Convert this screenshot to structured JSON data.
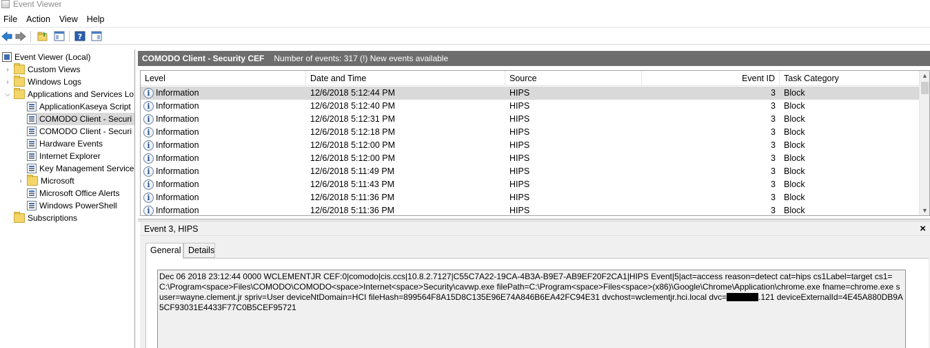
{
  "window": {
    "title": "Event Viewer"
  },
  "menu": [
    "File",
    "Action",
    "View",
    "Help"
  ],
  "toolbar": {
    "buttons": [
      "back-icon",
      "forward-icon",
      "open-folder-icon",
      "show-hide-tree-icon",
      "help-icon",
      "show-hide-action-pane-icon"
    ]
  },
  "tree": {
    "root": "Event Viewer (Local)",
    "custom_views": "Custom Views",
    "windows_logs": "Windows Logs",
    "apps_services": "Applications and Services Lo",
    "children": [
      "ApplicationKaseya Script",
      "COMODO Client - Securi",
      "COMODO Client - Securi",
      "Hardware Events",
      "Internet Explorer",
      "Key Management Service",
      "Microsoft",
      "Microsoft Office Alerts",
      "Windows PowerShell"
    ],
    "subscriptions": "Subscriptions"
  },
  "header": {
    "log_name": "COMODO Client - Security CEF",
    "event_count": "Number of events: 317 (!) New events available"
  },
  "grid": {
    "columns": {
      "level": "Level",
      "datetime": "Date and Time",
      "source": "Source",
      "event_id": "Event ID",
      "task_category": "Task Category"
    },
    "rows": [
      {
        "level": "Information",
        "datetime": "12/6/2018 5:12:44 PM",
        "source": "HIPS",
        "event_id": "3",
        "task": "Block"
      },
      {
        "level": "Information",
        "datetime": "12/6/2018 5:12:40 PM",
        "source": "HIPS",
        "event_id": "3",
        "task": "Block"
      },
      {
        "level": "Information",
        "datetime": "12/6/2018 5:12:31 PM",
        "source": "HIPS",
        "event_id": "3",
        "task": "Block"
      },
      {
        "level": "Information",
        "datetime": "12/6/2018 5:12:18 PM",
        "source": "HIPS",
        "event_id": "3",
        "task": "Block"
      },
      {
        "level": "Information",
        "datetime": "12/6/2018 5:12:00 PM",
        "source": "HIPS",
        "event_id": "3",
        "task": "Block"
      },
      {
        "level": "Information",
        "datetime": "12/6/2018 5:12:00 PM",
        "source": "HIPS",
        "event_id": "3",
        "task": "Block"
      },
      {
        "level": "Information",
        "datetime": "12/6/2018 5:11:49 PM",
        "source": "HIPS",
        "event_id": "3",
        "task": "Block"
      },
      {
        "level": "Information",
        "datetime": "12/6/2018 5:11:43 PM",
        "source": "HIPS",
        "event_id": "3",
        "task": "Block"
      },
      {
        "level": "Information",
        "datetime": "12/6/2018 5:11:36 PM",
        "source": "HIPS",
        "event_id": "3",
        "task": "Block"
      },
      {
        "level": "Information",
        "datetime": "12/6/2018 5:11:36 PM",
        "source": "HIPS",
        "event_id": "3",
        "task": "Block"
      }
    ]
  },
  "detail": {
    "title": "Event 3, HIPS",
    "close_glyph": "×",
    "tabs": [
      "General",
      "Details"
    ],
    "message_before": "Dec 06 2018 23:12:44 0000 WCLEMENTJR CEF:0|comodo|cis.ccs|10.8.2.7127|C55C7A22-19CA-4B3A-B9E7-AB9EF20F2CA1|HIPS Event|5|act=access reason=detect cat=hips cs1Label=target cs1=C:\\Program<space>Files\\COMODO\\COMODO<space>Internet<space>Security\\cavwp.exe filePath=C:\\Program<space>Files<space>(x86)\\Google\\Chrome\\Application\\chrome.exe fname=chrome.exe suser=wayne.clement.jr spriv=User deviceNtDomain=HCI fileHash=899564F8A15D8C135E96E74A846B6EA42FC94E31 dvchost=wclementjr.hci.local dvc=",
    "message_after": ".121 deviceExternalId=4E45A880DB9A5CF93031E4433F77C0B5CEF95721"
  }
}
